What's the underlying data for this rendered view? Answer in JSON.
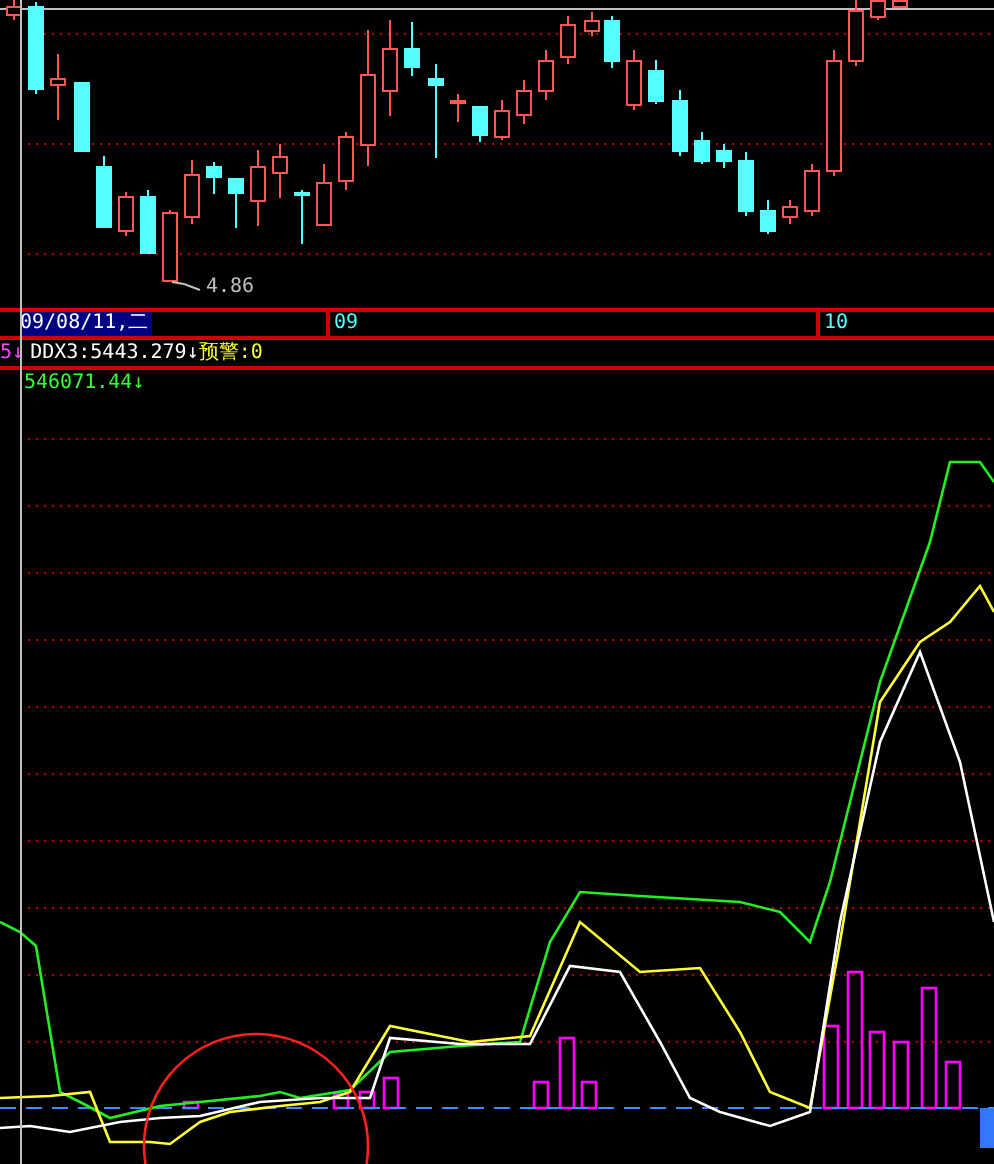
{
  "price_panel": {
    "low_label": "4.86"
  },
  "time_axis": {
    "cursor_date": "09/08/11,二",
    "month_labels": [
      {
        "text": "09"
      },
      {
        "text": "10"
      }
    ]
  },
  "indicator_legend": {
    "cut_value": "5",
    "cut_arrow": "↓",
    "ddx": "DDX3:5443.279",
    "ddx_arrow": "↓",
    "alert": "预警:0"
  },
  "indicator_value": {
    "value": "546071.44",
    "arrow": "↓"
  }
}
